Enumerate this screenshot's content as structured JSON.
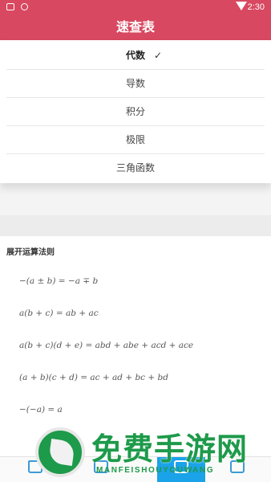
{
  "status_bar": {
    "time": "2:30"
  },
  "app_bar": {
    "title": "速查表"
  },
  "menu": {
    "items": [
      {
        "label": "代数",
        "selected": true
      },
      {
        "label": "导数"
      },
      {
        "label": "积分"
      },
      {
        "label": "极限"
      },
      {
        "label": "三角函数"
      }
    ],
    "check_mark": "✓"
  },
  "content": {
    "section_title": "展开运算法则",
    "formulas": [
      "−(a ± b) = −a ∓ b",
      "a(b + c) = ab + ac",
      "a(b + c)(d + e) = abd + abe + acd + ace",
      "(a + b)(c + d) = ac + ad + bc + bd",
      "−(−a) = a"
    ]
  },
  "bottom_nav": {
    "tabs": [
      {
        "icon": "home-icon"
      },
      {
        "icon": "book-icon"
      },
      {
        "icon": "chat-icon",
        "active": true
      },
      {
        "icon": "profile-icon"
      }
    ]
  },
  "watermark": {
    "title": "免费手游网",
    "subtitle": "MANFEISHOUYOUWANG"
  }
}
